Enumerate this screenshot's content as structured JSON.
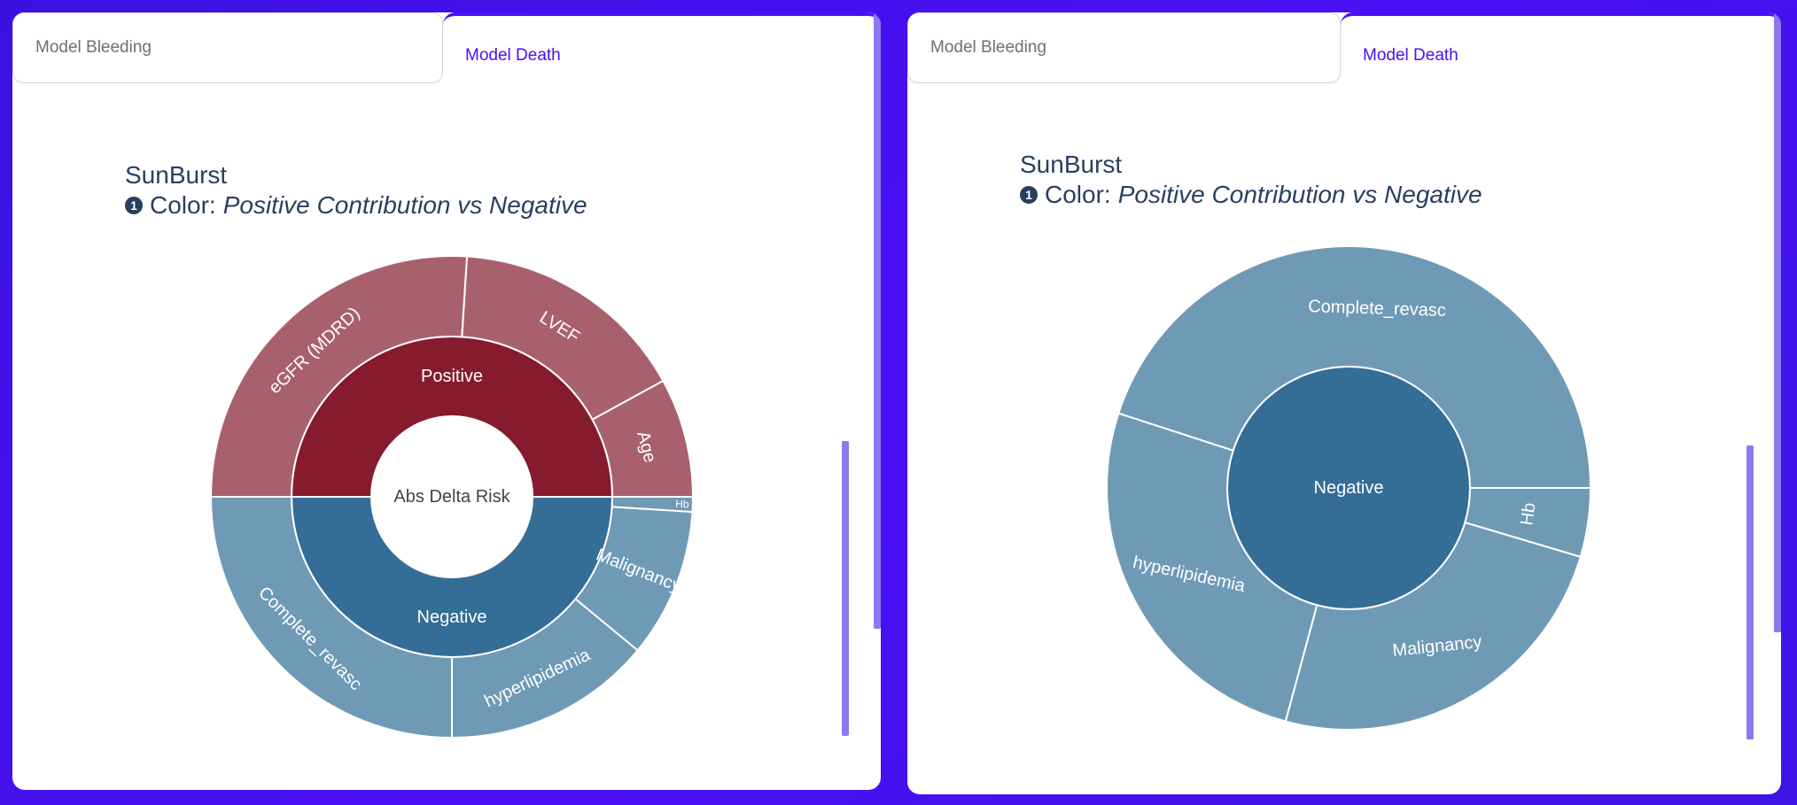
{
  "tabs": {
    "bleeding_label": "Model Bleeding",
    "death_label": "Model Death"
  },
  "colors": {
    "positive_inner": "#861b2d",
    "positive_outer": "#a8616c",
    "negative_inner": "#346d96",
    "negative_outer": "#6f9ab6",
    "tab_active": "#4a10f5",
    "title_text": "#2a3f5f"
  },
  "chart_data": [
    {
      "type": "sunburst",
      "title": "SunBurst",
      "subtitle_prefix": "Color:",
      "subtitle_emphasis": "Positive Contribution vs Negative",
      "info_icon": "info-circle-icon",
      "center_label": "Abs Delta Risk",
      "hierarchy": [
        {
          "name": "Positive",
          "value": 50,
          "color_role": "positive",
          "children": [
            {
              "name": "eGFR (MDRD)",
              "value": 26
            },
            {
              "name": "LVEF",
              "value": 16
            },
            {
              "name": "Age",
              "value": 8
            }
          ]
        },
        {
          "name": "Negative",
          "value": 50,
          "color_role": "negative",
          "children": [
            {
              "name": "Hb",
              "value": 1
            },
            {
              "name": "Malignancy",
              "value": 10
            },
            {
              "name": "hyperlipidemia",
              "value": 14
            },
            {
              "name": "Complete_revasc",
              "value": 25
            }
          ]
        }
      ]
    },
    {
      "type": "sunburst",
      "title": "SunBurst",
      "subtitle_prefix": "Color:",
      "subtitle_emphasis": "Positive Contribution vs Negative",
      "info_icon": "info-circle-icon",
      "center_label": "",
      "hierarchy": [
        {
          "name": "Negative",
          "value": 100,
          "color_role": "negative",
          "children": [
            {
              "name": "Hb",
              "value": 4.6
            },
            {
              "name": "Malignancy",
              "value": 24.6
            },
            {
              "name": "hyperlipidemia",
              "value": 25.8
            },
            {
              "name": "Complete_revasc",
              "value": 45.0
            }
          ]
        }
      ]
    }
  ]
}
